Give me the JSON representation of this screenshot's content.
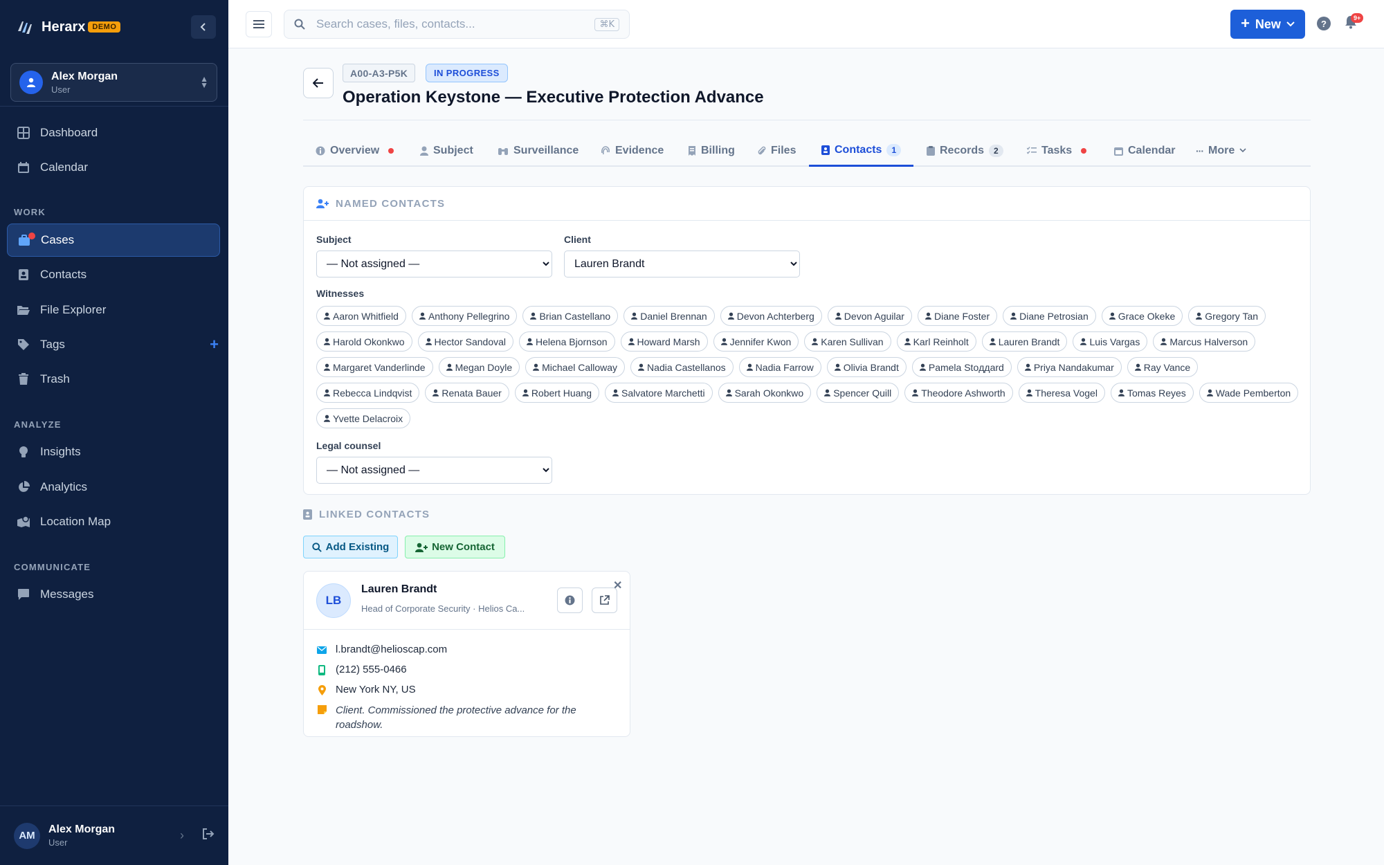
{
  "app": {
    "name": "Herarx",
    "badge": "DEMO"
  },
  "user": {
    "name": "Alex Morgan",
    "role": "User",
    "initials": "AM"
  },
  "nav": {
    "main": [
      {
        "label": "Dashboard"
      },
      {
        "label": "Calendar"
      }
    ],
    "work_title": "WORK",
    "work": [
      {
        "label": "Cases"
      },
      {
        "label": "Contacts"
      },
      {
        "label": "File Explorer"
      },
      {
        "label": "Tags"
      },
      {
        "label": "Trash"
      }
    ],
    "analyze_title": "ANALYZE",
    "analyze": [
      {
        "label": "Insights"
      },
      {
        "label": "Analytics"
      },
      {
        "label": "Location Map"
      }
    ],
    "communicate_title": "COMMUNICATE",
    "communicate": [
      {
        "label": "Messages"
      }
    ]
  },
  "topbar": {
    "search_placeholder": "Search cases, files, contacts...",
    "shortcut": "⌘K",
    "new_label": "New",
    "notif_count": "9+"
  },
  "case": {
    "id": "A00-A3-P5K",
    "status": "IN PROGRESS",
    "title": "Operation Keystone — Executive Protection Advance"
  },
  "tabs": [
    {
      "label": "Overview"
    },
    {
      "label": "Subject"
    },
    {
      "label": "Surveillance"
    },
    {
      "label": "Evidence"
    },
    {
      "label": "Billing"
    },
    {
      "label": "Files"
    },
    {
      "label": "Contacts",
      "count": "1"
    },
    {
      "label": "Records",
      "count": "2"
    },
    {
      "label": "Tasks"
    },
    {
      "label": "Calendar"
    },
    {
      "label": "More"
    }
  ],
  "named_contacts": {
    "title": "NAMED CONTACTS",
    "subject_label": "Subject",
    "subject_value": "— Not assigned —",
    "client_label": "Client",
    "client_value": "Lauren Brandt",
    "witnesses_label": "Witnesses",
    "witnesses": [
      "Aaron Whitfield",
      "Anthony Pellegrino",
      "Brian Castellano",
      "Daniel Brennan",
      "Devon Achterberg",
      "Devon Aguilar",
      "Diane Foster",
      "Diane Petrosian",
      "Grace Okeke",
      "Gregory Tan",
      "Harold Okonkwo",
      "Hector Sandoval",
      "Helena Bjornson",
      "Howard Marsh",
      "Jennifer Kwon",
      "Karen Sullivan",
      "Karl Reinholt",
      "Lauren Brandt",
      "Luis Vargas",
      "Marcus Halverson",
      "Margaret Vanderlinde",
      "Megan Doyle",
      "Michael Calloway",
      "Nadia Castellanos",
      "Nadia Farrow",
      "Olivia Brandt",
      "Pamela Stoддard",
      "Priya Nandakumar",
      "Ray Vance",
      "Rebecca Lindqvist",
      "Renata Bauer",
      "Robert Huang",
      "Salvatore Marchetti",
      "Sarah Okonkwo",
      "Spencer Quill",
      "Theodore Ashworth",
      "Theresa Vogel",
      "Tomas Reyes",
      "Wade Pemberton",
      "Yvette Delacroix"
    ],
    "legal_label": "Legal counsel",
    "legal_value": "— Not assigned —"
  },
  "linked_contacts": {
    "title": "LINKED CONTACTS",
    "add_existing": "Add Existing",
    "new_contact": "New Contact",
    "contact": {
      "initials": "LB",
      "name": "Lauren Brandt",
      "subtitle": "Head of Corporate Security · Helios Ca...",
      "email": "l.brandt@helioscap.com",
      "phone": "(212) 555-0466",
      "location": "New York NY, US",
      "note": "Client. Commissioned the protective advance for the roadshow."
    }
  }
}
